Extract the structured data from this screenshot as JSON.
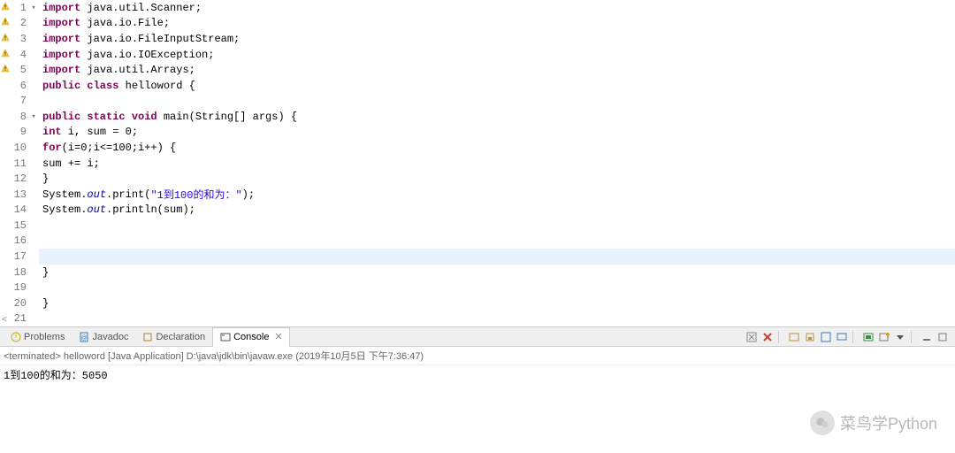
{
  "code": {
    "lines": [
      {
        "n": 1,
        "ann": "warn",
        "fold": "▾",
        "tokens": [
          [
            "kw",
            "import"
          ],
          [
            "tks",
            " java.util.Scanner;"
          ]
        ]
      },
      {
        "n": 2,
        "ann": "warn",
        "fold": "",
        "tokens": [
          [
            "kw",
            "import"
          ],
          [
            "tks",
            " java.io.File;"
          ]
        ]
      },
      {
        "n": 3,
        "ann": "warn",
        "fold": "",
        "tokens": [
          [
            "kw",
            "import"
          ],
          [
            "tks",
            " java.io.FileInputStream;"
          ]
        ]
      },
      {
        "n": 4,
        "ann": "warn",
        "fold": "",
        "tokens": [
          [
            "kw",
            "import"
          ],
          [
            "tks",
            " java.io.IOException;"
          ]
        ]
      },
      {
        "n": 5,
        "ann": "warn",
        "fold": "",
        "tokens": [
          [
            "kw",
            "import"
          ],
          [
            "tks",
            " java.util.Arrays;"
          ]
        ]
      },
      {
        "n": 6,
        "ann": "",
        "fold": "",
        "tokens": [
          [
            "kw",
            "public class"
          ],
          [
            "tks",
            " helloword {"
          ]
        ]
      },
      {
        "n": 7,
        "ann": "",
        "fold": "",
        "tokens": []
      },
      {
        "n": 8,
        "ann": "",
        "fold": "▾",
        "indent": 1,
        "tokens": [
          [
            "kw",
            "public static void"
          ],
          [
            "tks",
            " main(String[] args) {"
          ]
        ]
      },
      {
        "n": 9,
        "ann": "",
        "fold": "",
        "indent": 2,
        "tokens": [
          [
            "kw",
            "int"
          ],
          [
            "tks",
            " i, sum = 0;"
          ]
        ]
      },
      {
        "n": 10,
        "ann": "",
        "fold": "",
        "indent": 2,
        "tokens": [
          [
            "kw",
            "for"
          ],
          [
            "tks",
            "(i=0;i<=100;i++) {"
          ]
        ]
      },
      {
        "n": 11,
        "ann": "",
        "fold": "",
        "indent": 3,
        "tokens": [
          [
            "tks",
            "sum += i;"
          ]
        ]
      },
      {
        "n": 12,
        "ann": "",
        "fold": "",
        "indent": 2,
        "tokens": [
          [
            "tks",
            "}"
          ]
        ]
      },
      {
        "n": 13,
        "ann": "",
        "fold": "",
        "indent": 2,
        "tokens": [
          [
            "tks",
            "System."
          ],
          [
            "fld",
            "out"
          ],
          [
            "tks",
            ".print("
          ],
          [
            "str",
            "\"1到100的和为：\""
          ],
          [
            "tks",
            ");"
          ]
        ]
      },
      {
        "n": 14,
        "ann": "",
        "fold": "",
        "indent": 2,
        "tokens": [
          [
            "tks",
            "System."
          ],
          [
            "fld",
            "out"
          ],
          [
            "tks",
            ".println(sum);"
          ]
        ]
      },
      {
        "n": 15,
        "ann": "",
        "fold": "",
        "tokens": []
      },
      {
        "n": 16,
        "ann": "",
        "fold": "",
        "tokens": []
      },
      {
        "n": 17,
        "ann": "",
        "fold": "",
        "highlight": true,
        "tokens": []
      },
      {
        "n": 18,
        "ann": "",
        "fold": "",
        "indent": 1,
        "tokens": [
          [
            "tks",
            "}"
          ]
        ]
      },
      {
        "n": 19,
        "ann": "",
        "fold": "",
        "tokens": []
      },
      {
        "n": 20,
        "ann": "",
        "fold": "",
        "tokens": [
          [
            "tks",
            "}"
          ]
        ]
      },
      {
        "n": 21,
        "ann": "",
        "fold": "",
        "tokens": []
      }
    ]
  },
  "tabs": {
    "items": [
      {
        "label": "Problems",
        "icon": "problems-icon",
        "active": false
      },
      {
        "label": "Javadoc",
        "icon": "javadoc-icon",
        "active": false
      },
      {
        "label": "Declaration",
        "icon": "declaration-icon",
        "active": false
      },
      {
        "label": "Console",
        "icon": "console-icon",
        "active": true,
        "close": true
      }
    ]
  },
  "console": {
    "terminated": "<terminated> helloword [Java Application] D:\\java\\jdk\\bin\\javaw.exe (2019年10月5日 下午7:36:47)",
    "output": "1到100的和为：5050"
  },
  "watermark": {
    "text": "菜鸟学Python"
  }
}
